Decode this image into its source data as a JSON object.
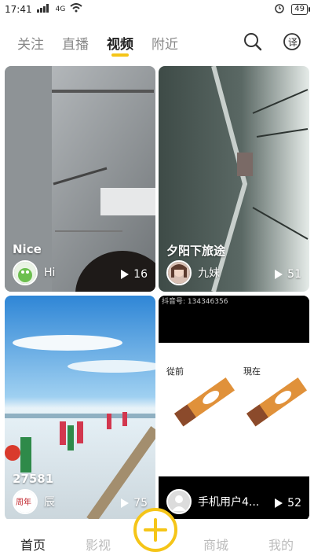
{
  "status_bar": {
    "time": "17:41",
    "network": "4G",
    "battery": "49"
  },
  "top_tabs": [
    "关注",
    "直播",
    "视频",
    "附近"
  ],
  "active_tab_index": 2,
  "cards": [
    {
      "title": "Nice",
      "user": "Hi",
      "plays": "16"
    },
    {
      "title": "夕阳下旅途",
      "user": "九妹",
      "plays": "51"
    },
    {
      "title": "27581",
      "user": "辰",
      "plays": "75",
      "overlay_text": "周年"
    },
    {
      "title": "",
      "user": "手机用户4...",
      "plays": "52",
      "top_text": "抖音号: 134346356",
      "label_left": "從前",
      "label_right": "現在"
    }
  ],
  "bottom_nav": [
    "首页",
    "影视",
    "",
    "商城",
    "我的"
  ],
  "active_bottom_index": 0,
  "colors": {
    "accent": "#f5c518"
  }
}
